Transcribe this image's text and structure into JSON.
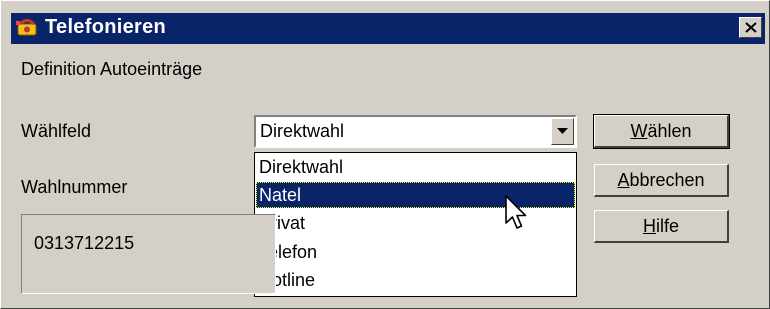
{
  "window": {
    "title": "Telefonieren",
    "close_label": "Close"
  },
  "section": {
    "title": "Definition Autoeinträge"
  },
  "form": {
    "waehlfeld_label": "Wählfeld",
    "wahlnummer_label": "Wahlnummer",
    "waehlfeld_value": "Direktwahl",
    "wahlnummer_value": "0313712215"
  },
  "dropdown": {
    "options": [
      "Direktwahl",
      "Natel",
      "Privat",
      "Telefon",
      "Hotline"
    ],
    "highlighted": "Natel"
  },
  "buttons": {
    "dial": {
      "accel": "W",
      "rest": "ählen"
    },
    "cancel": {
      "accel": "A",
      "rest": "bbrechen"
    },
    "help": {
      "accel": "H",
      "rest": "ilfe"
    }
  },
  "colors": {
    "titlebar": "#0a246a",
    "face": "#d4d0c8",
    "highlight": "#0a246a"
  },
  "icons": [
    "phone-app-icon",
    "close-icon",
    "dropdown-arrow-icon",
    "mouse-cursor-icon"
  ]
}
